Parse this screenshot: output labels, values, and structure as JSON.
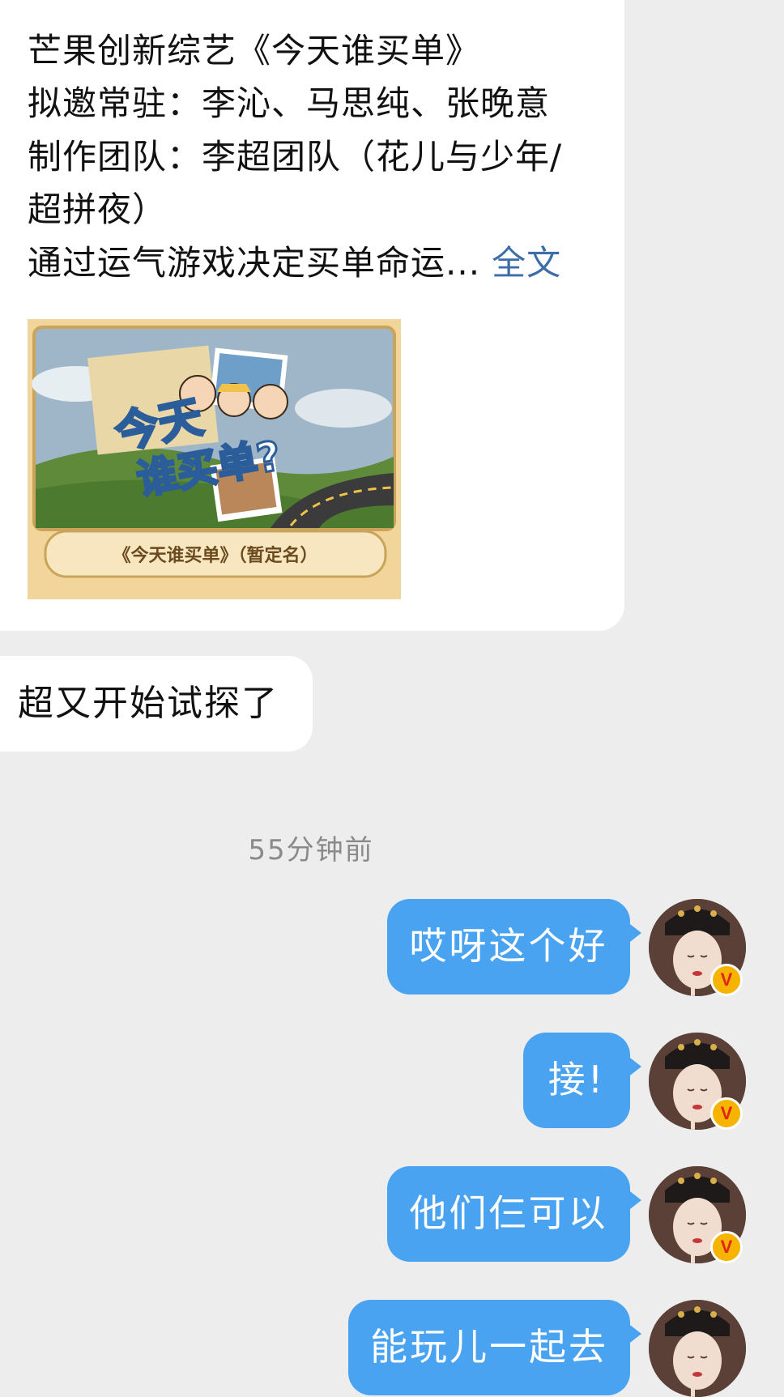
{
  "post": {
    "line1": "芒果创新综艺《今天谁买单》",
    "line2": "拟邀常驻：李沁、马思纯、张晚意",
    "line3": "制作团队：李超团队（花儿与少年/",
    "line4": "超拼夜）",
    "line5": "通过运气游戏决定买单命运...",
    "full_text_link": "全文",
    "poster_title": "今天谁买单?",
    "poster_caption": "《今天谁买单》（暂定名）"
  },
  "comment": {
    "text": "超又开始试探了"
  },
  "timestamp": "55分钟前",
  "messages": [
    {
      "text": "哎呀这个好"
    },
    {
      "text": "接!"
    },
    {
      "text": "他们仨可以"
    },
    {
      "text": "能玩儿一起去"
    }
  ],
  "badge": {
    "label": "V"
  },
  "colors": {
    "background": "#ededed",
    "bubble_in": "#ffffff",
    "bubble_out": "#4aa3f1",
    "link": "#3d6da8",
    "badge": "#f6b400"
  }
}
